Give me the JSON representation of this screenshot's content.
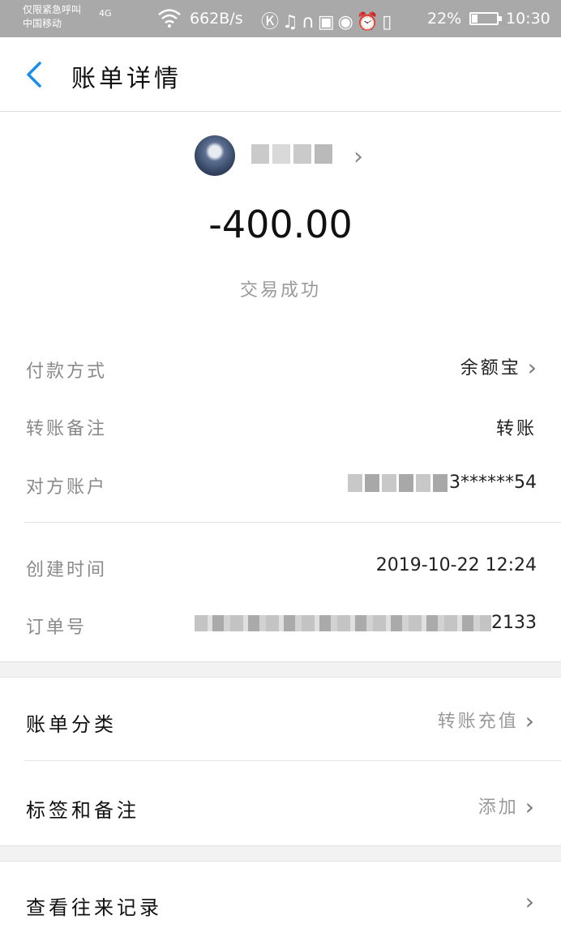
{
  "status_bar": {
    "carrier_line1": "仅限紧急呼叫",
    "carrier_line2": "中国移动",
    "network": "4G",
    "speed": "662B/s",
    "battery": "22%",
    "time": "10:30"
  },
  "nav": {
    "title": "账单详情"
  },
  "header": {
    "amount": "-400.00",
    "status": "交易成功"
  },
  "details": {
    "payment_method_label": "付款方式",
    "payment_method_value": "余额宝",
    "transfer_note_label": "转账备注",
    "transfer_note_value": "转账",
    "counterparty_label": "对方账户",
    "counterparty_value": "3******54",
    "created_time_label": "创建时间",
    "created_time_value": "2019-10-22 12:24",
    "order_no_label": "订单号",
    "order_no_value": "2133"
  },
  "menu": {
    "category_label": "账单分类",
    "category_value": "转账充值",
    "tags_label": "标签和备注",
    "tags_value": "添加",
    "history_label": "查看往来记录"
  },
  "colors": {
    "accent": "#1a8ee8",
    "status_bar": "#a9a9a9"
  },
  "battery_level": 0.22
}
